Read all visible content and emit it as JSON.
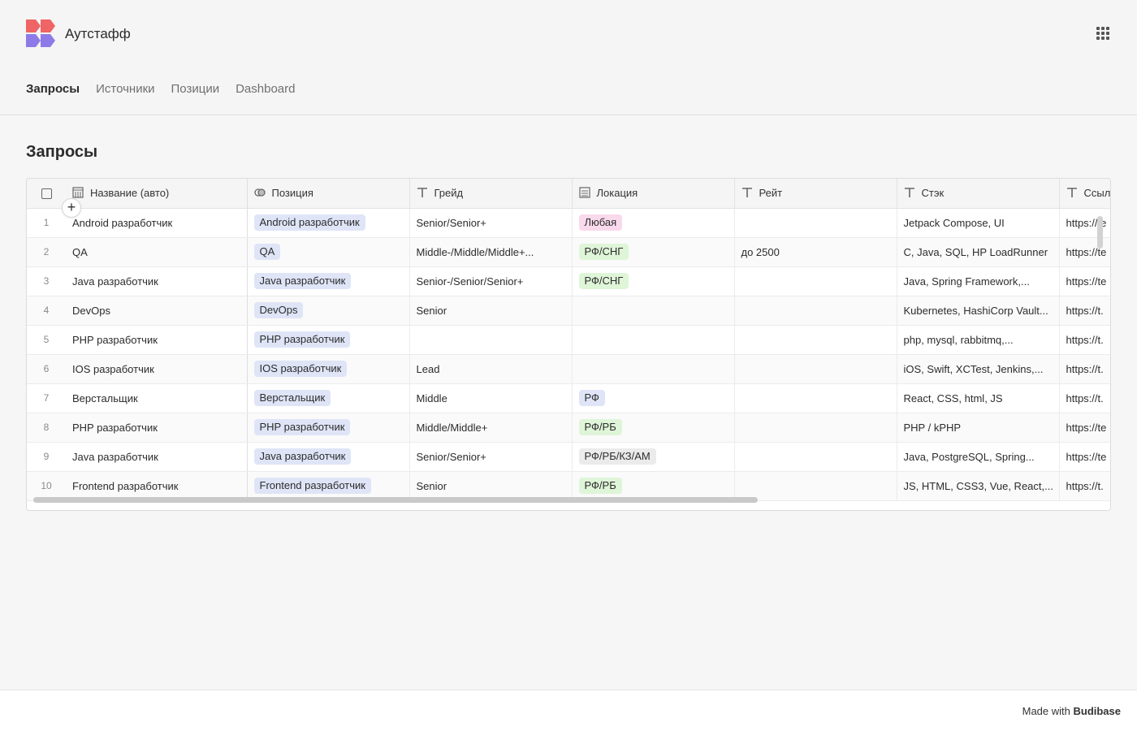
{
  "app": {
    "title": "Аутстафф"
  },
  "nav": [
    {
      "label": "Запросы",
      "active": true
    },
    {
      "label": "Источники",
      "active": false
    },
    {
      "label": "Позиции",
      "active": false
    },
    {
      "label": "Dashboard",
      "active": false
    }
  ],
  "page": {
    "title": "Запросы"
  },
  "table": {
    "columns": [
      {
        "label": "Название (авто)",
        "icon": "formula-icon"
      },
      {
        "label": "Позиция",
        "icon": "link-icon"
      },
      {
        "label": "Грейд",
        "icon": "text-icon"
      },
      {
        "label": "Локация",
        "icon": "options-icon"
      },
      {
        "label": "Рейт",
        "icon": "text-icon"
      },
      {
        "label": "Стэк",
        "icon": "text-icon"
      },
      {
        "label": "Ссылка",
        "icon": "text-icon"
      }
    ],
    "rows": [
      {
        "num": "1",
        "name": "Android разработчик",
        "position": "Android разработчик",
        "grade": "Senior/Senior+",
        "location": "Любая",
        "location_color": "#f9d9ec",
        "rate": "",
        "stack": "Jetpack Compose, UI",
        "link": "https://te"
      },
      {
        "num": "2",
        "name": "QA",
        "position": "QA",
        "grade": "Middle-/Middle/Middle+...",
        "location": "РФ/СНГ",
        "location_color": "#dff5d8",
        "rate": "до 2500",
        "stack": "C, Java, SQL, HP LoadRunner",
        "link": "https://te"
      },
      {
        "num": "3",
        "name": "Java разработчик",
        "position": "Java разработчик",
        "grade": "Senior-/Senior/Senior+",
        "location": "РФ/СНГ",
        "location_color": "#dff5d8",
        "rate": "",
        "stack": "Java, Spring Framework,...",
        "link": "https://te"
      },
      {
        "num": "4",
        "name": "DevOps",
        "position": "DevOps",
        "grade": "Senior",
        "location": "",
        "location_color": "",
        "rate": "",
        "stack": "Kubernetes, HashiCorp Vault...",
        "link": "https://t."
      },
      {
        "num": "5",
        "name": "PHP разработчик",
        "position": "PHP разработчик",
        "grade": "",
        "location": "",
        "location_color": "",
        "rate": "",
        "stack": "php, mysql, rabbitmq,...",
        "link": "https://t."
      },
      {
        "num": "6",
        "name": "IOS разработчик",
        "position": "IOS разработчик",
        "grade": "Lead",
        "location": "",
        "location_color": "",
        "rate": "",
        "stack": "iOS, Swift, XCTest, Jenkins,...",
        "link": "https://t."
      },
      {
        "num": "7",
        "name": "Верстальщик",
        "position": "Верстальщик",
        "grade": "Middle",
        "location": "РФ",
        "location_color": "#dfe5f7",
        "rate": "",
        "stack": "React, CSS, html, JS",
        "link": "https://t."
      },
      {
        "num": "8",
        "name": "PHP разработчик",
        "position": "PHP разработчик",
        "grade": "Middle/Middle+",
        "location": "РФ/РБ",
        "location_color": "#dff5d8",
        "rate": "",
        "stack": "PHP / kPHP",
        "link": "https://te"
      },
      {
        "num": "9",
        "name": "Java разработчик",
        "position": "Java разработчик",
        "grade": "Senior/Senior+",
        "location": "РФ/РБ/КЗ/АМ",
        "location_color": "#ebebeb",
        "rate": "",
        "stack": "Java, PostgreSQL, Spring...",
        "link": "https://te"
      },
      {
        "num": "10",
        "name": "Frontend разработчик",
        "position": "Frontend разработчик",
        "grade": "Senior",
        "location": "РФ/РБ",
        "location_color": "#dff5d8",
        "rate": "",
        "stack": "JS, HTML, CSS3, Vue, React,...",
        "link": "https://t."
      }
    ]
  },
  "footer": {
    "made_with": "Made with",
    "brand": "Budibase"
  }
}
